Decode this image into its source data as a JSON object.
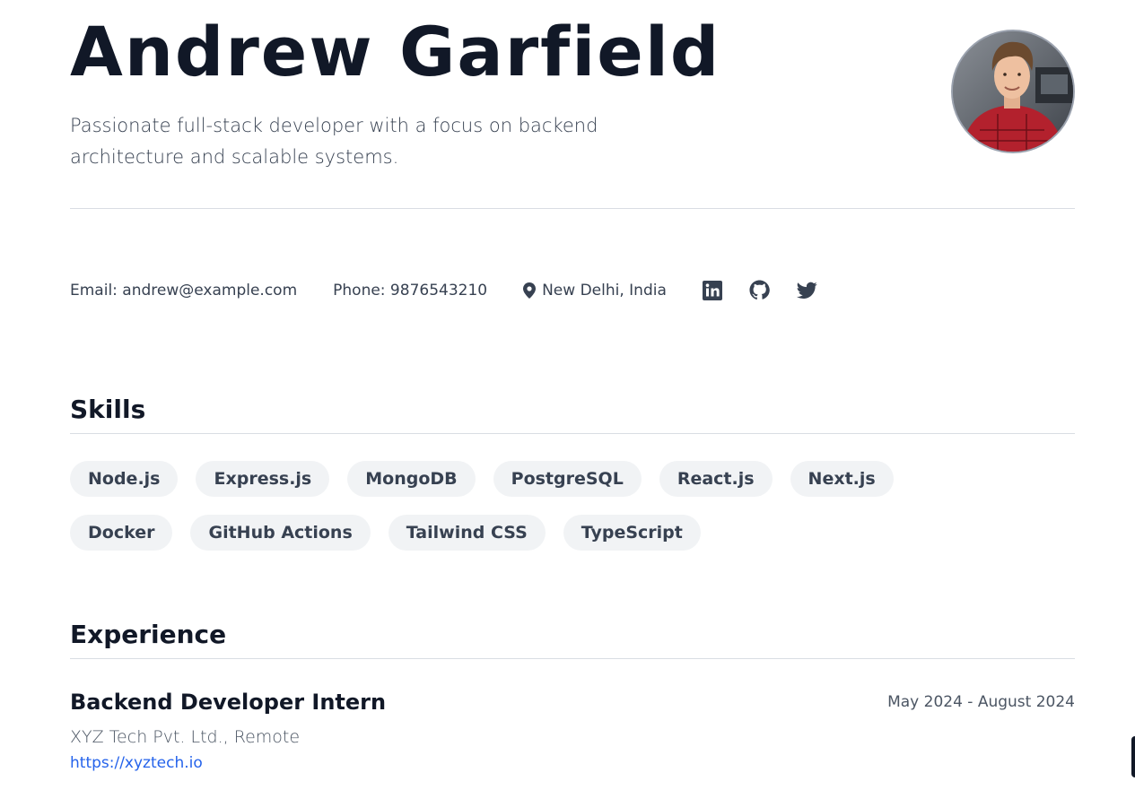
{
  "profile": {
    "name": "Andrew Garfield",
    "tagline": "Passionate full-stack developer with a focus on backend architecture and scalable systems."
  },
  "contact": {
    "email": "Email: andrew@example.com",
    "phone": "Phone: 9876543210",
    "location": "New Delhi, India",
    "icons": [
      "location-pin-icon",
      "linkedin-icon",
      "github-icon",
      "twitter-icon"
    ]
  },
  "skills": {
    "title": "Skills",
    "items": [
      "Node.js",
      "Express.js",
      "MongoDB",
      "PostgreSQL",
      "React.js",
      "Next.js",
      "Docker",
      "GitHub Actions",
      "Tailwind CSS",
      "TypeScript"
    ]
  },
  "experience": {
    "title": "Experience",
    "jobs": [
      {
        "role": "Backend Developer Intern",
        "dates": "May 2024 - August 2024",
        "company": "XYZ Tech Pvt. Ltd., Remote",
        "link": "https://xyztech.io"
      }
    ]
  },
  "colors": {
    "text": "#111827",
    "muted": "#4b5563",
    "chip_bg": "#f1f3f5",
    "link": "#2563eb",
    "divider": "#d9dde3"
  }
}
